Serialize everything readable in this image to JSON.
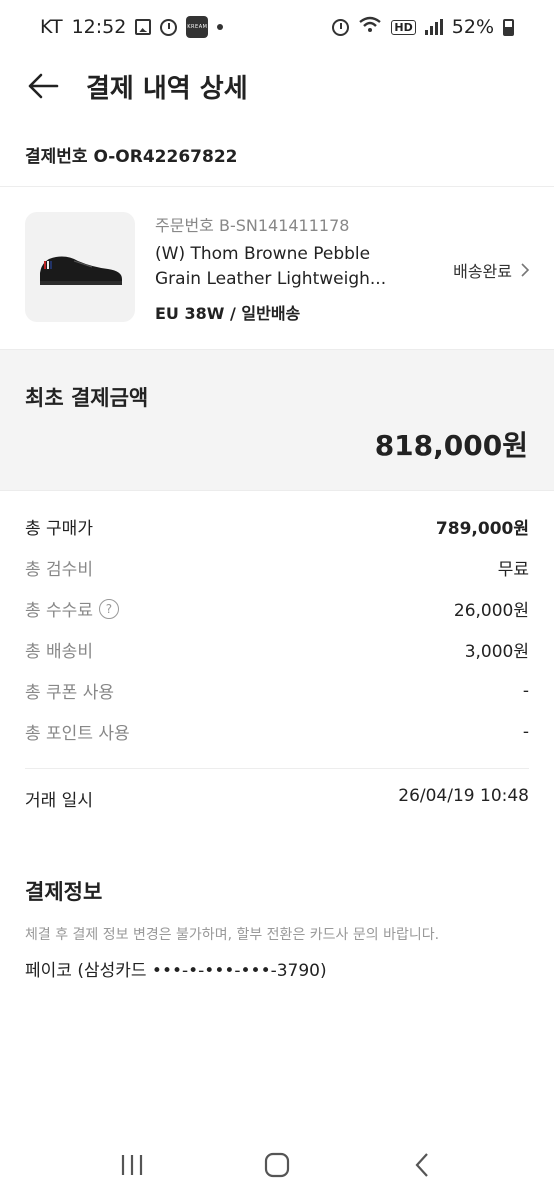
{
  "status_bar": {
    "carrier": "KT",
    "time": "12:52",
    "app_badge": "KREAM",
    "battery": "52%"
  },
  "header": {
    "title": "결제 내역 상세"
  },
  "payment_number": "결제번호 O-OR42267822",
  "product": {
    "order_number": "주문번호 B-SN141411178",
    "name_line1": "(W) Thom Browne Pebble",
    "name_line2": "Grain Leather Lightweigh...",
    "option": "EU 38W / 일반배송",
    "status": "배송완료"
  },
  "total": {
    "label": "최초 결제금액",
    "value": "818,000원"
  },
  "breakdown": [
    {
      "label": "총 구매가",
      "value": "789,000원"
    },
    {
      "label": "총 검수비",
      "value": "무료"
    },
    {
      "label": "총 수수료",
      "value": "26,000원"
    },
    {
      "label": "총 배송비",
      "value": "3,000원"
    },
    {
      "label": "총 쿠폰 사용",
      "value": "-"
    },
    {
      "label": "총 포인트 사용",
      "value": "-"
    }
  ],
  "trade": {
    "label": "거래 일시",
    "value": "26/04/19 10:48"
  },
  "payment_info": {
    "title": "결제정보",
    "notice": "체결 후 결제 정보 변경은 불가하며, 할부 전환은 카드사 문의 바랍니다.",
    "method": "페이코 (삼성카드 •••-•-•••-•••-3790)"
  },
  "icons": {
    "back": "arrow-left-icon",
    "status_chevron": "chevron-right-icon",
    "help": "question-circle-icon",
    "nav_recents": "recents-icon",
    "nav_home": "home-icon",
    "nav_back": "nav-back-icon"
  }
}
